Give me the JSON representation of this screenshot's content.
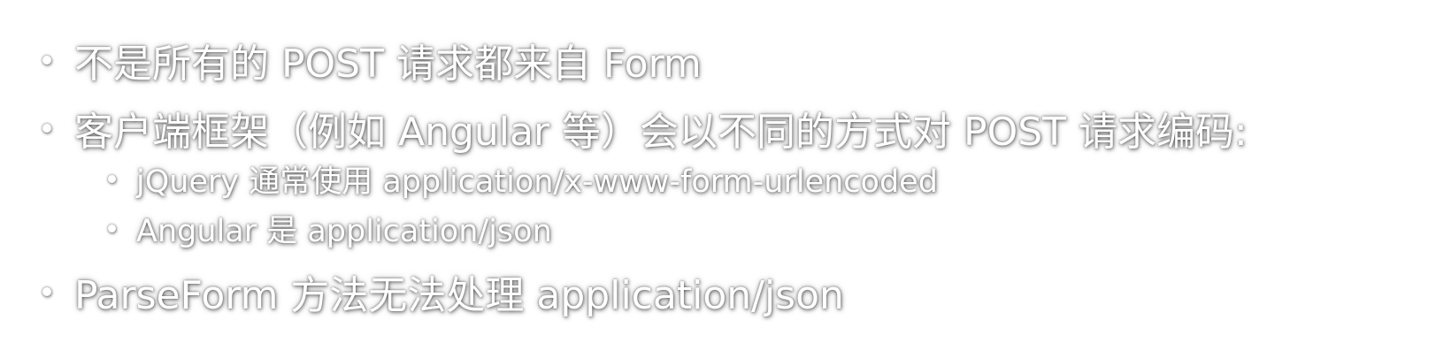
{
  "slide": {
    "bullets": [
      {
        "text": "不是所有的 POST 请求都来自 Form"
      },
      {
        "text": "客户端框架（例如 Angular 等）会以不同的方式对 POST 请求编码:",
        "children": [
          {
            "text": "jQuery 通常使用 application/x-www-form-urlencoded"
          },
          {
            "text": "Angular 是 application/json"
          }
        ]
      },
      {
        "text": "ParseForm 方法无法处理 application/json"
      }
    ]
  }
}
